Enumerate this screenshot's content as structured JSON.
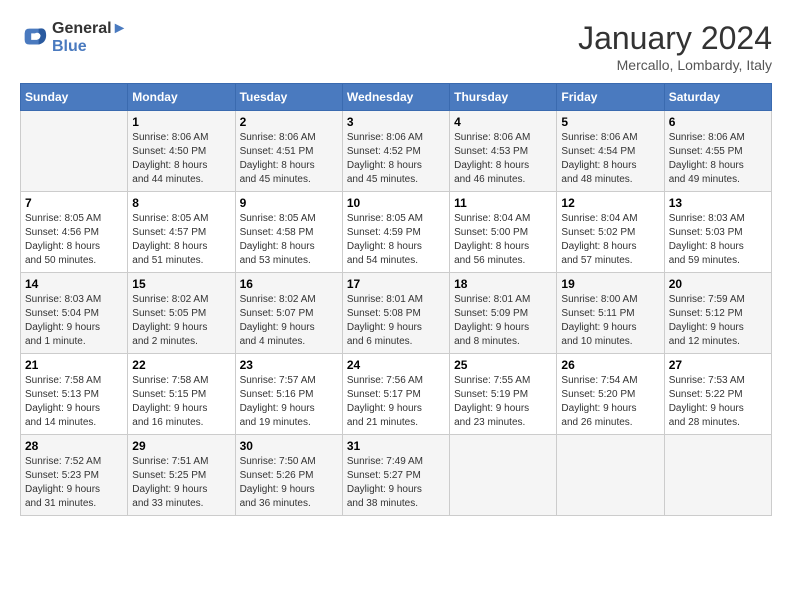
{
  "header": {
    "logo_line1": "General",
    "logo_line2": "Blue",
    "month": "January 2024",
    "location": "Mercallo, Lombardy, Italy"
  },
  "days_of_week": [
    "Sunday",
    "Monday",
    "Tuesday",
    "Wednesday",
    "Thursday",
    "Friday",
    "Saturday"
  ],
  "weeks": [
    [
      {
        "day": "",
        "info": ""
      },
      {
        "day": "1",
        "info": "Sunrise: 8:06 AM\nSunset: 4:50 PM\nDaylight: 8 hours\nand 44 minutes."
      },
      {
        "day": "2",
        "info": "Sunrise: 8:06 AM\nSunset: 4:51 PM\nDaylight: 8 hours\nand 45 minutes."
      },
      {
        "day": "3",
        "info": "Sunrise: 8:06 AM\nSunset: 4:52 PM\nDaylight: 8 hours\nand 45 minutes."
      },
      {
        "day": "4",
        "info": "Sunrise: 8:06 AM\nSunset: 4:53 PM\nDaylight: 8 hours\nand 46 minutes."
      },
      {
        "day": "5",
        "info": "Sunrise: 8:06 AM\nSunset: 4:54 PM\nDaylight: 8 hours\nand 48 minutes."
      },
      {
        "day": "6",
        "info": "Sunrise: 8:06 AM\nSunset: 4:55 PM\nDaylight: 8 hours\nand 49 minutes."
      }
    ],
    [
      {
        "day": "7",
        "info": "Sunrise: 8:05 AM\nSunset: 4:56 PM\nDaylight: 8 hours\nand 50 minutes."
      },
      {
        "day": "8",
        "info": "Sunrise: 8:05 AM\nSunset: 4:57 PM\nDaylight: 8 hours\nand 51 minutes."
      },
      {
        "day": "9",
        "info": "Sunrise: 8:05 AM\nSunset: 4:58 PM\nDaylight: 8 hours\nand 53 minutes."
      },
      {
        "day": "10",
        "info": "Sunrise: 8:05 AM\nSunset: 4:59 PM\nDaylight: 8 hours\nand 54 minutes."
      },
      {
        "day": "11",
        "info": "Sunrise: 8:04 AM\nSunset: 5:00 PM\nDaylight: 8 hours\nand 56 minutes."
      },
      {
        "day": "12",
        "info": "Sunrise: 8:04 AM\nSunset: 5:02 PM\nDaylight: 8 hours\nand 57 minutes."
      },
      {
        "day": "13",
        "info": "Sunrise: 8:03 AM\nSunset: 5:03 PM\nDaylight: 8 hours\nand 59 minutes."
      }
    ],
    [
      {
        "day": "14",
        "info": "Sunrise: 8:03 AM\nSunset: 5:04 PM\nDaylight: 9 hours\nand 1 minute."
      },
      {
        "day": "15",
        "info": "Sunrise: 8:02 AM\nSunset: 5:05 PM\nDaylight: 9 hours\nand 2 minutes."
      },
      {
        "day": "16",
        "info": "Sunrise: 8:02 AM\nSunset: 5:07 PM\nDaylight: 9 hours\nand 4 minutes."
      },
      {
        "day": "17",
        "info": "Sunrise: 8:01 AM\nSunset: 5:08 PM\nDaylight: 9 hours\nand 6 minutes."
      },
      {
        "day": "18",
        "info": "Sunrise: 8:01 AM\nSunset: 5:09 PM\nDaylight: 9 hours\nand 8 minutes."
      },
      {
        "day": "19",
        "info": "Sunrise: 8:00 AM\nSunset: 5:11 PM\nDaylight: 9 hours\nand 10 minutes."
      },
      {
        "day": "20",
        "info": "Sunrise: 7:59 AM\nSunset: 5:12 PM\nDaylight: 9 hours\nand 12 minutes."
      }
    ],
    [
      {
        "day": "21",
        "info": "Sunrise: 7:58 AM\nSunset: 5:13 PM\nDaylight: 9 hours\nand 14 minutes."
      },
      {
        "day": "22",
        "info": "Sunrise: 7:58 AM\nSunset: 5:15 PM\nDaylight: 9 hours\nand 16 minutes."
      },
      {
        "day": "23",
        "info": "Sunrise: 7:57 AM\nSunset: 5:16 PM\nDaylight: 9 hours\nand 19 minutes."
      },
      {
        "day": "24",
        "info": "Sunrise: 7:56 AM\nSunset: 5:17 PM\nDaylight: 9 hours\nand 21 minutes."
      },
      {
        "day": "25",
        "info": "Sunrise: 7:55 AM\nSunset: 5:19 PM\nDaylight: 9 hours\nand 23 minutes."
      },
      {
        "day": "26",
        "info": "Sunrise: 7:54 AM\nSunset: 5:20 PM\nDaylight: 9 hours\nand 26 minutes."
      },
      {
        "day": "27",
        "info": "Sunrise: 7:53 AM\nSunset: 5:22 PM\nDaylight: 9 hours\nand 28 minutes."
      }
    ],
    [
      {
        "day": "28",
        "info": "Sunrise: 7:52 AM\nSunset: 5:23 PM\nDaylight: 9 hours\nand 31 minutes."
      },
      {
        "day": "29",
        "info": "Sunrise: 7:51 AM\nSunset: 5:25 PM\nDaylight: 9 hours\nand 33 minutes."
      },
      {
        "day": "30",
        "info": "Sunrise: 7:50 AM\nSunset: 5:26 PM\nDaylight: 9 hours\nand 36 minutes."
      },
      {
        "day": "31",
        "info": "Sunrise: 7:49 AM\nSunset: 5:27 PM\nDaylight: 9 hours\nand 38 minutes."
      },
      {
        "day": "",
        "info": ""
      },
      {
        "day": "",
        "info": ""
      },
      {
        "day": "",
        "info": ""
      }
    ]
  ]
}
